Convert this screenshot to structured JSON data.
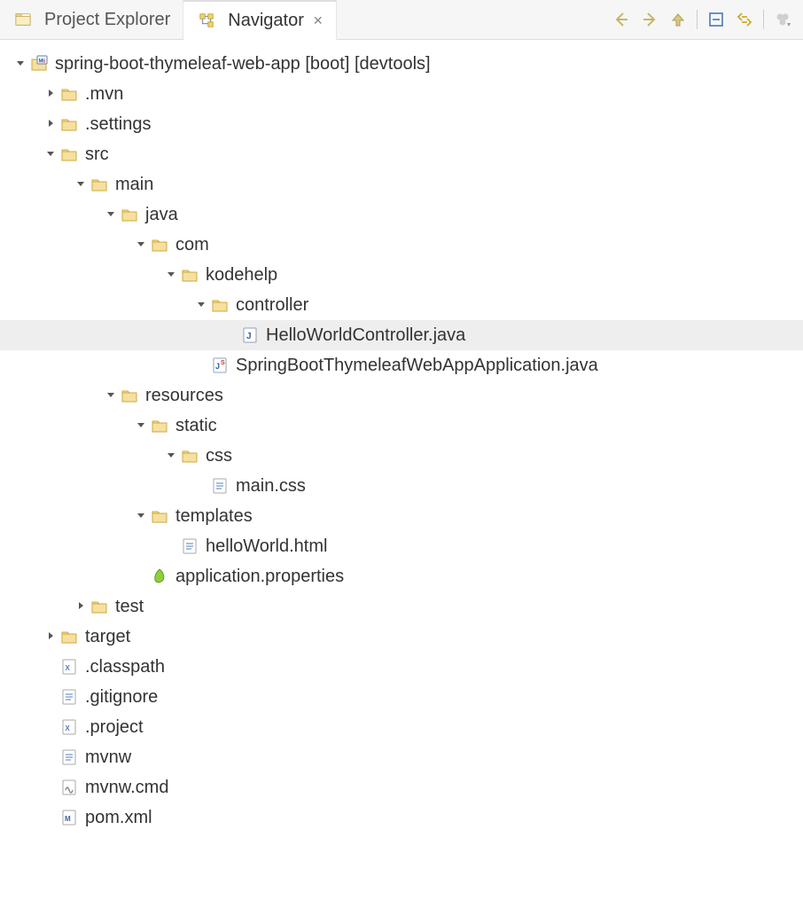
{
  "tabs": {
    "project_explorer": "Project Explorer",
    "navigator": "Navigator"
  },
  "tree": [
    {
      "depth": 0,
      "twisty": "open",
      "icon": "maven-project",
      "label": "spring-boot-thymeleaf-web-app [boot] [devtools]",
      "selected": false
    },
    {
      "depth": 1,
      "twisty": "closed",
      "icon": "folder",
      "label": ".mvn"
    },
    {
      "depth": 1,
      "twisty": "closed",
      "icon": "folder",
      "label": ".settings"
    },
    {
      "depth": 1,
      "twisty": "open",
      "icon": "folder",
      "label": "src"
    },
    {
      "depth": 2,
      "twisty": "open",
      "icon": "folder",
      "label": "main"
    },
    {
      "depth": 3,
      "twisty": "open",
      "icon": "folder",
      "label": "java"
    },
    {
      "depth": 4,
      "twisty": "open",
      "icon": "folder",
      "label": "com"
    },
    {
      "depth": 5,
      "twisty": "open",
      "icon": "folder",
      "label": "kodehelp"
    },
    {
      "depth": 6,
      "twisty": "open",
      "icon": "folder",
      "label": "controller"
    },
    {
      "depth": 7,
      "twisty": "none",
      "icon": "java-file",
      "label": "HelloWorldController.java",
      "selected": true
    },
    {
      "depth": 6,
      "twisty": "none",
      "icon": "java-spring",
      "label": "SpringBootThymeleafWebAppApplication.java"
    },
    {
      "depth": 3,
      "twisty": "open",
      "icon": "folder",
      "label": "resources"
    },
    {
      "depth": 4,
      "twisty": "open",
      "icon": "folder",
      "label": "static"
    },
    {
      "depth": 5,
      "twisty": "open",
      "icon": "folder",
      "label": "css"
    },
    {
      "depth": 6,
      "twisty": "none",
      "icon": "text-file",
      "label": "main.css"
    },
    {
      "depth": 4,
      "twisty": "open",
      "icon": "folder",
      "label": "templates"
    },
    {
      "depth": 5,
      "twisty": "none",
      "icon": "text-file",
      "label": "helloWorld.html"
    },
    {
      "depth": 4,
      "twisty": "none",
      "icon": "properties",
      "label": "application.properties"
    },
    {
      "depth": 2,
      "twisty": "closed",
      "icon": "folder",
      "label": "test"
    },
    {
      "depth": 1,
      "twisty": "closed",
      "icon": "folder",
      "label": "target"
    },
    {
      "depth": 1,
      "twisty": "none",
      "icon": "xml-file",
      "label": ".classpath"
    },
    {
      "depth": 1,
      "twisty": "none",
      "icon": "text-file",
      "label": ".gitignore"
    },
    {
      "depth": 1,
      "twisty": "none",
      "icon": "xml-file",
      "label": ".project"
    },
    {
      "depth": 1,
      "twisty": "none",
      "icon": "text-file",
      "label": "mvnw"
    },
    {
      "depth": 1,
      "twisty": "none",
      "icon": "cmd-file",
      "label": "mvnw.cmd"
    },
    {
      "depth": 1,
      "twisty": "none",
      "icon": "maven-file",
      "label": "pom.xml"
    }
  ]
}
